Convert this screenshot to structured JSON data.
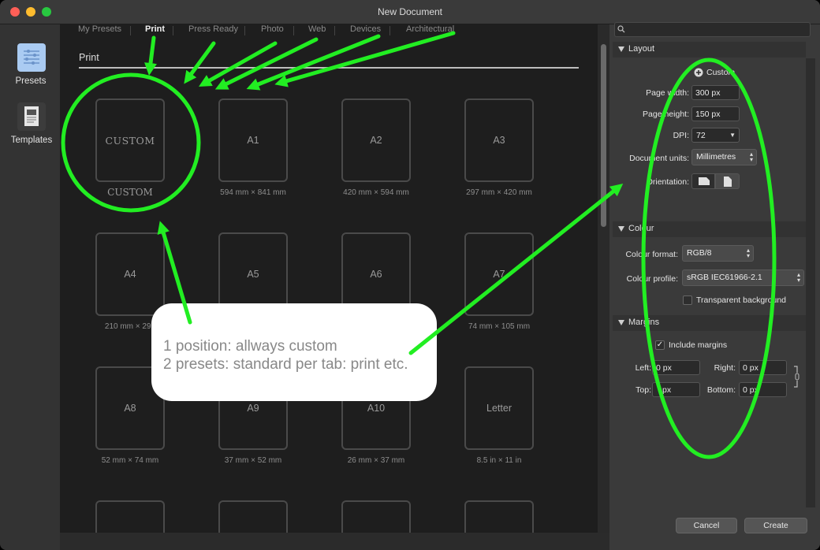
{
  "window": {
    "title": "New Document"
  },
  "traffic_lights": [
    "#fe5f57",
    "#febc2e",
    "#28c840"
  ],
  "sidebar": {
    "items": [
      {
        "label": "Presets",
        "icon": "presets-icon",
        "active": true
      },
      {
        "label": "Templates",
        "icon": "templates-icon",
        "active": false
      }
    ]
  },
  "tabs": [
    {
      "label": "My Presets",
      "active": false
    },
    {
      "label": "Print",
      "active": true
    },
    {
      "label": "Press Ready",
      "active": false
    },
    {
      "label": "Photo",
      "active": false
    },
    {
      "label": "Web",
      "active": false
    },
    {
      "label": "Devices",
      "active": false
    },
    {
      "label": "Architectural",
      "active": false
    }
  ],
  "section_title": "Print",
  "presets": [
    {
      "name": "CUSTOM",
      "dims": "CUSTOM"
    },
    {
      "name": "A1",
      "dims": "594 mm × 841 mm"
    },
    {
      "name": "A2",
      "dims": "420 mm × 594 mm"
    },
    {
      "name": "A3",
      "dims": "297 mm × 420 mm"
    },
    {
      "name": "A4",
      "dims": "210 mm × 297"
    },
    {
      "name": "A5",
      "dims": ""
    },
    {
      "name": "A6",
      "dims": ""
    },
    {
      "name": "A7",
      "dims": "74 mm × 105 mm"
    },
    {
      "name": "A8",
      "dims": "52 mm × 74 mm"
    },
    {
      "name": "A9",
      "dims": "37 mm × 52 mm"
    },
    {
      "name": "A10",
      "dims": "26 mm × 37 mm"
    },
    {
      "name": "Letter",
      "dims": "8.5 in × 11 in"
    },
    {
      "name": "",
      "dims": ""
    },
    {
      "name": "",
      "dims": ""
    },
    {
      "name": "",
      "dims": ""
    },
    {
      "name": "",
      "dims": ""
    }
  ],
  "right_panel": {
    "search_placeholder": "",
    "layout": {
      "title": "Layout",
      "custom_label": "Custom",
      "page_width_label": "Page width:",
      "page_width": "300 px",
      "page_height_label": "Page height:",
      "page_height": "150 px",
      "dpi_label": "DPI:",
      "dpi": "72",
      "units_label": "Document units:",
      "units": "Millimetres",
      "orientation_label": "Orientation:"
    },
    "colour": {
      "title": "Colour",
      "format_label": "Colour format:",
      "format": "RGB/8",
      "profile_label": "Colour profile:",
      "profile": "sRGB IEC61966-2.1",
      "transparent_label": "Transparent background",
      "transparent_checked": false
    },
    "margins": {
      "title": "Margins",
      "include_label": "Include margins",
      "include_checked": true,
      "left_label": "Left:",
      "left": "0 px",
      "right_label": "Right:",
      "right": "0 px",
      "top_label": "Top:",
      "top": "px",
      "bottom_label": "Bottom:",
      "bottom": "0 px"
    }
  },
  "buttons": {
    "cancel": "Cancel",
    "create": "Create"
  },
  "annotation": {
    "line1": "1 position: allways custom",
    "line2": "2 presets: standard per tab: print etc.",
    "color": "#22ee22"
  }
}
